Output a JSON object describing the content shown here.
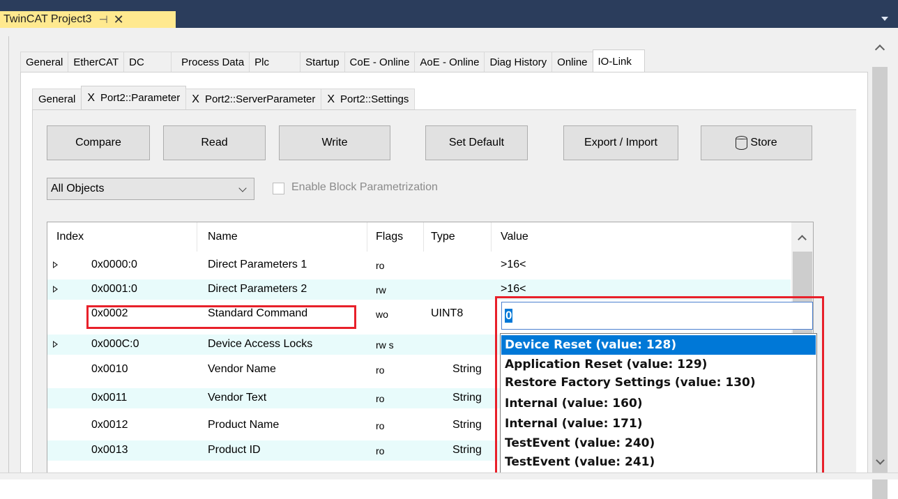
{
  "window": {
    "doc_tab_title": "TwinCAT Project3",
    "pin_glyph": "⊣",
    "close_glyph": "✕"
  },
  "main_tabs": [
    "General",
    "EtherCAT",
    "DC",
    "Process Data",
    "Plc",
    "Startup",
    "CoE - Online",
    "AoE - Online",
    "Diag History",
    "Online",
    "IO-Link"
  ],
  "active_main_tab": "IO-Link",
  "sub_tabs": [
    {
      "label": "General",
      "closable": false
    },
    {
      "label": "Port2::Parameter",
      "closable": true
    },
    {
      "label": "Port2::ServerParameter",
      "closable": true
    },
    {
      "label": "Port2::Settings",
      "closable": true
    }
  ],
  "sub_tab_close_glyph": "X",
  "toolbar": {
    "compare": "Compare",
    "read": "Read",
    "write": "Write",
    "set_default": "Set Default",
    "export_import": "Export / Import",
    "store": "Store"
  },
  "filter": {
    "selected": "All Objects",
    "block_param_label": "Enable Block Parametrization",
    "block_param_checked": false
  },
  "table": {
    "columns": [
      "Index",
      "Name",
      "Flags",
      "Type",
      "Value"
    ],
    "rows": [
      {
        "expand": true,
        "index": "0x0000:0",
        "name": "Direct Parameters 1",
        "flags": "ro",
        "type": "",
        "value": ">16<"
      },
      {
        "expand": true,
        "index": "0x0001:0",
        "name": "Direct Parameters 2",
        "flags": "rw",
        "type": "",
        "value": ">16<"
      },
      {
        "expand": false,
        "index": "0x0002",
        "name": "Standard Command",
        "flags": "wo",
        "type": "UINT8",
        "value": ""
      },
      {
        "expand": true,
        "index": "0x000C:0",
        "name": "Device Access Locks",
        "flags": "rw s",
        "type": "",
        "value": ""
      },
      {
        "expand": false,
        "index": "0x0010",
        "name": "Vendor Name",
        "flags": "ro",
        "type": "String",
        "value": ""
      },
      {
        "expand": false,
        "index": "0x0011",
        "name": "Vendor Text",
        "flags": "ro",
        "type": "String",
        "value": ""
      },
      {
        "expand": false,
        "index": "0x0012",
        "name": "Product Name",
        "flags": "ro",
        "type": "String",
        "value": ""
      },
      {
        "expand": false,
        "index": "0x0013",
        "name": "Product ID",
        "flags": "ro",
        "type": "String",
        "value": ""
      }
    ]
  },
  "editor": {
    "value": "0",
    "options": [
      "Device Reset (value: 128)",
      "Application Reset (value: 129)",
      "Restore Factory Settings (value: 130)",
      "Internal (value: 160)",
      "Internal (value: 171)",
      "TestEvent (value: 240)",
      "TestEvent (value: 241)"
    ],
    "highlighted_option": "Device Reset (value: 128)"
  },
  "colors": {
    "title_bar": "#2b3d5c",
    "doc_tab": "#ffe98f",
    "alt_row": "#e8fbfb",
    "selection": "#0078d7",
    "highlight_box": "#e8202a"
  }
}
